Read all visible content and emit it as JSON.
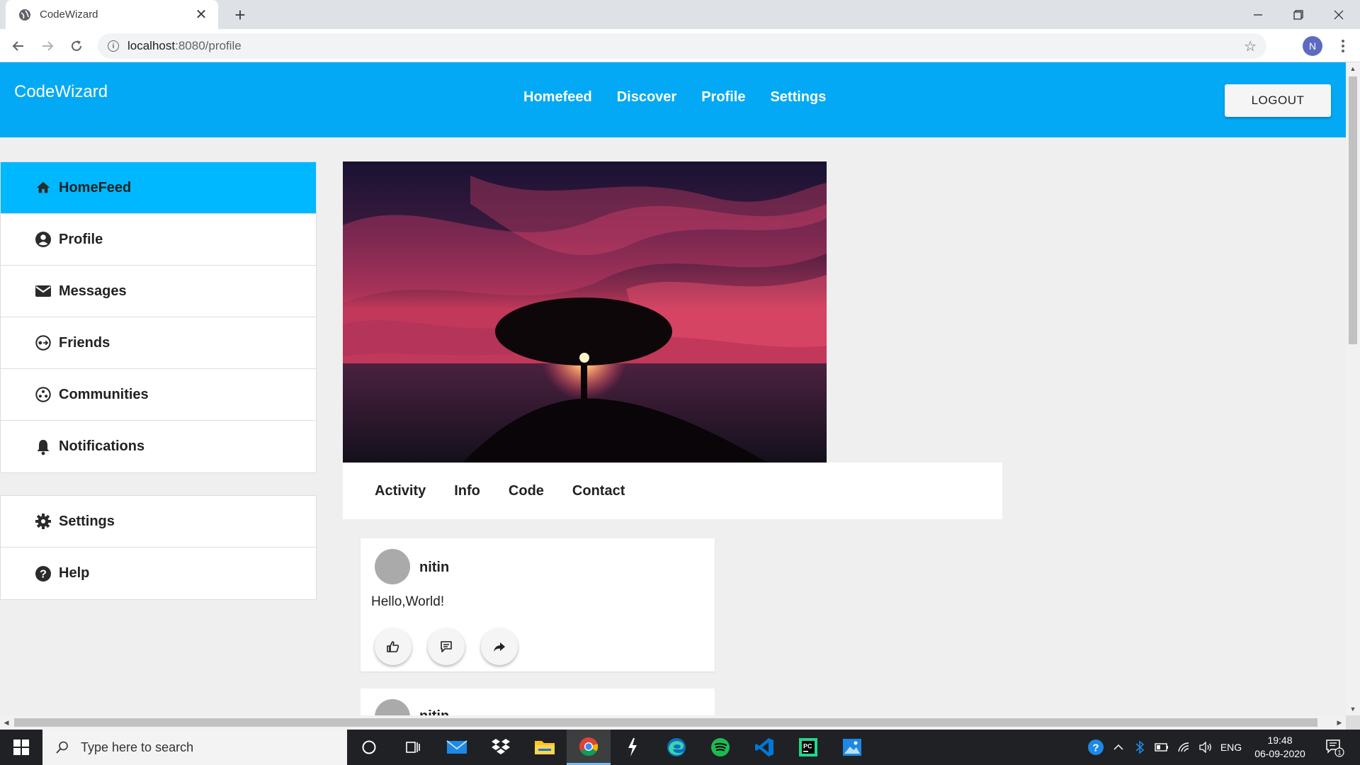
{
  "browser": {
    "tab_title": "CodeWizard",
    "url_host": "localhost",
    "url_rest": ":8080/profile",
    "profile_initial": "N"
  },
  "app": {
    "brand": "CodeWizard",
    "nav": [
      "Homefeed",
      "Discover",
      "Profile",
      "Settings"
    ],
    "logout_label": "LOGOUT"
  },
  "sidebar": {
    "items": [
      {
        "label": "HomeFeed",
        "icon": "home-icon",
        "active": true
      },
      {
        "label": "Profile",
        "icon": "account-circle-icon"
      },
      {
        "label": "Messages",
        "icon": "mail-icon"
      },
      {
        "label": "Friends",
        "icon": "friends-icon"
      },
      {
        "label": "Communities",
        "icon": "communities-icon"
      },
      {
        "label": "Notifications",
        "icon": "bell-icon"
      }
    ],
    "bottom_items": [
      {
        "label": "Settings",
        "icon": "gear-icon"
      },
      {
        "label": "Help",
        "icon": "help-icon"
      }
    ]
  },
  "profile_tabs": [
    "Activity",
    "Info",
    "Code",
    "Contact"
  ],
  "posts": [
    {
      "author": "nitin",
      "text": "Hello,World!",
      "actions": [
        "like-icon",
        "comment-icon",
        "share-icon"
      ]
    },
    {
      "author": "nitin"
    }
  ],
  "taskbar": {
    "search_placeholder": "Type here to search",
    "language": "ENG",
    "time": "19:48",
    "date": "06-09-2020",
    "notification_count": "1"
  },
  "colors": {
    "header": "#03a9f4",
    "sidebar_active": "#00b8ff",
    "page_bg": "#efefef"
  }
}
